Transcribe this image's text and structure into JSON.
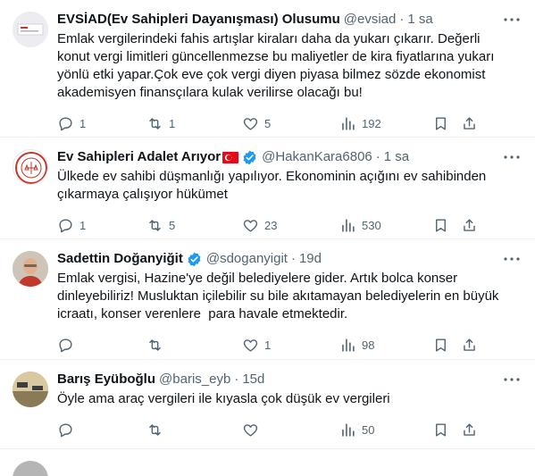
{
  "tweets": [
    {
      "name": "EVSİAD(Ev Sahipleri Dayanışması) Olusumu",
      "handle": "@evsiad",
      "time": "1 sa",
      "verified": false,
      "text": "Emlak vergilerindeki fahis artışlar kiraları daha da yukarı çıkarır. Değerli konut vergi limitleri güncellenmezse bu maliyetler de kira fiyatlarına yukarı yönlü etki yapar.Çok eve çok vergi diyen piyasa bilmez sözde ekonomist akademisyen finansçılara kulak verilirse olacağı bu!",
      "replies": "1",
      "retweets": "1",
      "likes": "5",
      "views": "192"
    },
    {
      "name": "Ev Sahipleri Adalet Arıyor",
      "handle": "@HakanKara6806",
      "time": "1 sa",
      "verified": true,
      "text": "Ülkede ev sahibi düşmanlığı yapılıyor. Ekonominin açığını ev sahibinden çıkarmaya çalışıyor hükümet",
      "replies": "1",
      "retweets": "5",
      "likes": "23",
      "views": "530"
    },
    {
      "name": "Sadettin Doğanyiğit",
      "handle": "@sdoganyigit",
      "time": "19d",
      "verified": true,
      "text": "Emlak vergisi, Hazine'ye değil belediyelere gider. Artık bolca konser dinleyebiliriz! Musluktan içilebilir su bile akıtamayan belediyelerin en büyük icraatı, konser verenlere  para havale etmektedir.",
      "replies": "",
      "retweets": "",
      "likes": "1",
      "views": "98"
    },
    {
      "name": "Barış Eyüboğlu",
      "handle": "@baris_eyb",
      "time": "15d",
      "verified": false,
      "text": "Öyle ama araç vergileri ile kıyasla çok düşük ev vergileri",
      "replies": "",
      "retweets": "",
      "likes": "",
      "views": "50"
    }
  ],
  "ui": {
    "dot": "·"
  },
  "colors": {
    "text": "#0f1419",
    "muted": "#536471",
    "verified": "#1d9bf0",
    "divider": "#eff3f4"
  }
}
